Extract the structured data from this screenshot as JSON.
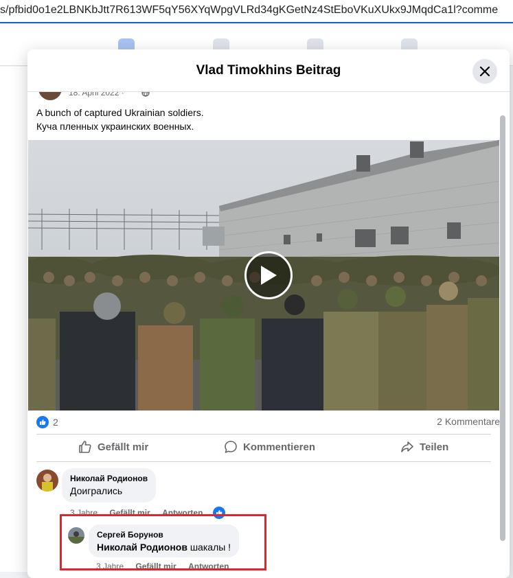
{
  "browser": {
    "url": "s/pfbid0o1e2LBNKbJtt7R613WF5qY56XYqWpgVLRd34gKGetNz4StEboVKuXUkx9JMqdCa1l?comme"
  },
  "dialog": {
    "title": "Vlad Timokhins Beitrag",
    "close_icon": "close-icon"
  },
  "post": {
    "date": "18. April 2022 · ",
    "text_line1": "A bunch of captured Ukrainian soldiers.",
    "text_line2": "Куча пленных украинских военных.",
    "reaction_count": "2",
    "comments_count": "2 Kommentare"
  },
  "actions": {
    "like_label": "Gefällt mir",
    "comment_label": "Kommentieren",
    "share_label": "Teilen"
  },
  "comments": [
    {
      "author": "Николай Родионов",
      "text": "Доигрались",
      "time": "3 Jahre",
      "like_label": "Gefällt mir",
      "reply_label": "Antworten"
    },
    {
      "author": "Сергей Борунов",
      "mention": "Николай Родионов",
      "text": " шакалы !",
      "time": "3 Jahre",
      "like_label": "Gefällt mir",
      "reply_label": "Antworten"
    }
  ],
  "colors": {
    "accent": "#1877f2",
    "highlight_box": "#e0262d"
  }
}
